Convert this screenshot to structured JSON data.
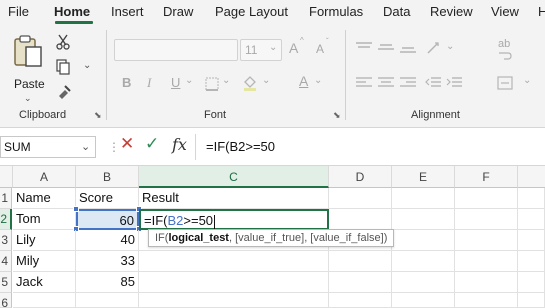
{
  "menu": {
    "tabs": [
      "File",
      "Home",
      "Insert",
      "Draw",
      "Page Layout",
      "Formulas",
      "Data",
      "Review",
      "View",
      "H"
    ],
    "active": "Home"
  },
  "ribbon": {
    "paste_label": "Paste",
    "groups": {
      "clipboard": "Clipboard",
      "font": "Font",
      "alignment": "Alignment"
    },
    "font_size": "11",
    "bold": "B",
    "italic": "I",
    "underline": "U",
    "grow_font": "A",
    "shrink_font": "A",
    "font_color": "A",
    "wrap_glyph": "ab"
  },
  "formula_bar": {
    "name_box": "SUM",
    "fx": "fx",
    "formula": "=IF(B2>=50"
  },
  "sheet": {
    "columns": [
      "A",
      "B",
      "C",
      "D",
      "E",
      "F"
    ],
    "rows": [
      "1",
      "2",
      "3",
      "4",
      "5",
      "6"
    ],
    "headers": {
      "name": "Name",
      "score": "Score",
      "result": "Result"
    },
    "data": [
      {
        "name": "Tom",
        "score": "60"
      },
      {
        "name": "Lily",
        "score": "40"
      },
      {
        "name": "Mily",
        "score": "33"
      },
      {
        "name": "Jack",
        "score": "85"
      }
    ],
    "editing": {
      "prefix": "=IF(",
      "ref": "B2",
      "suffix": ">=50"
    }
  },
  "tooltip": {
    "func": "IF(",
    "arg1": "logical_test",
    "rest": ", [value_if_true], [value_if_false])"
  },
  "colors": {
    "accent": "#217346",
    "reference": "#4472c4",
    "cancel": "#c3403a"
  }
}
